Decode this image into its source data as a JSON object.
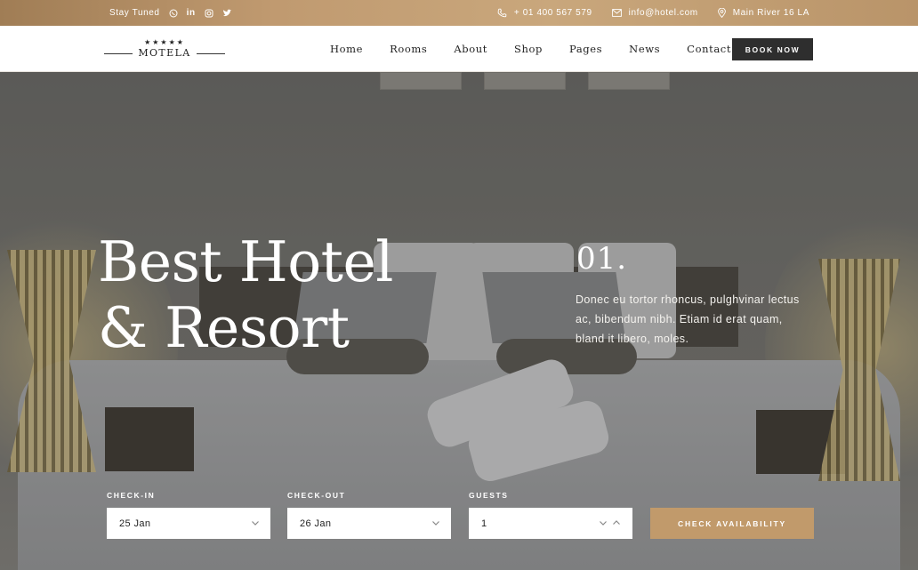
{
  "topbar": {
    "stay_tuned": "Stay Tuned",
    "social_icons": [
      "whatsapp-icon",
      "linkedin-icon",
      "instagram-icon",
      "twitter-icon"
    ],
    "phone": "+ 01 400 567 579",
    "email": "info@hotel.com",
    "address": "Main River 16 LA"
  },
  "header": {
    "logo_stars": "★★★★★",
    "logo_name": "MOTELA",
    "nav": [
      "Home",
      "Rooms",
      "About",
      "Shop",
      "Pages",
      "News",
      "Contact"
    ],
    "book_button": "BOOK NOW"
  },
  "hero": {
    "title_line1": "Best Hotel",
    "title_line2": "& Resort",
    "slide_number": "01.",
    "description": "Donec eu tortor rhoncus, pulghvinar lectus ac, bibendum nibh. Etiam id erat quam, bland it libero, moles."
  },
  "booking": {
    "checkin_label": "CHECK-IN",
    "checkin_value": "25 Jan",
    "checkout_label": "CHECK-OUT",
    "checkout_value": "26 Jan",
    "guests_label": "GUESTS",
    "guests_value": "1",
    "submit_label": "CHECK AVAILABILITY"
  },
  "colors": {
    "accent": "#c19a6b",
    "dark_button": "#2e2e2e",
    "topbar": "#c09a70"
  }
}
